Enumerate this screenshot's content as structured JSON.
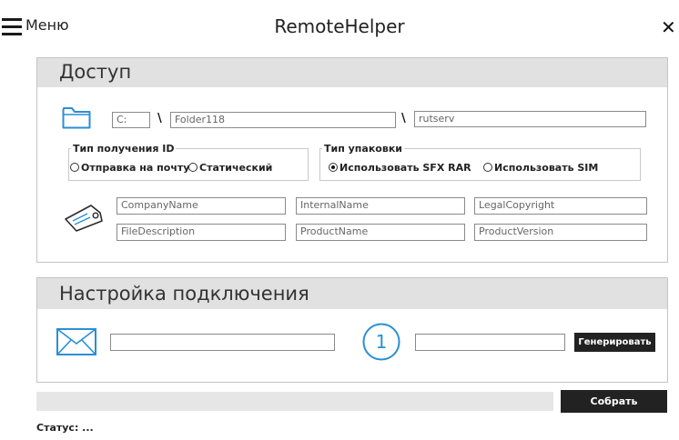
{
  "header": {
    "menu_label": "Меню",
    "app_title": "RemoteHelper",
    "close_label": "✕"
  },
  "access": {
    "title": "Доступ",
    "drive_value": "C:",
    "separator": "\\",
    "folder_value": "Folder118",
    "exe_value": "rutserv",
    "id_group": {
      "legend": "Тип получения ID",
      "options": [
        {
          "label": "Отправка на почту",
          "selected": false
        },
        {
          "label": "Статический",
          "selected": false
        }
      ]
    },
    "pack_group": {
      "legend": "Тип упаковки",
      "options": [
        {
          "label": "Использовать SFX RAR",
          "selected": true
        },
        {
          "label": "Использовать SIM",
          "selected": false
        }
      ]
    },
    "fields": {
      "company_name": "CompanyName",
      "internal_name": "InternalName",
      "legal_copyright": "LegalCopyright",
      "file_description": "FileDescription",
      "product_name": "ProductName",
      "product_version": "ProductVersion"
    }
  },
  "connection": {
    "title": "Настройка подключения",
    "email_value": "",
    "step_number": "1",
    "code_value": "",
    "generate_label": "Генерировать"
  },
  "footer": {
    "progress_fraction": 0,
    "build_label": "Собрать",
    "status_text": "Статус: ..."
  },
  "colors": {
    "accent": "#2a8fd6",
    "panel_header": "#e1e1e1",
    "button_dark": "#222222"
  }
}
